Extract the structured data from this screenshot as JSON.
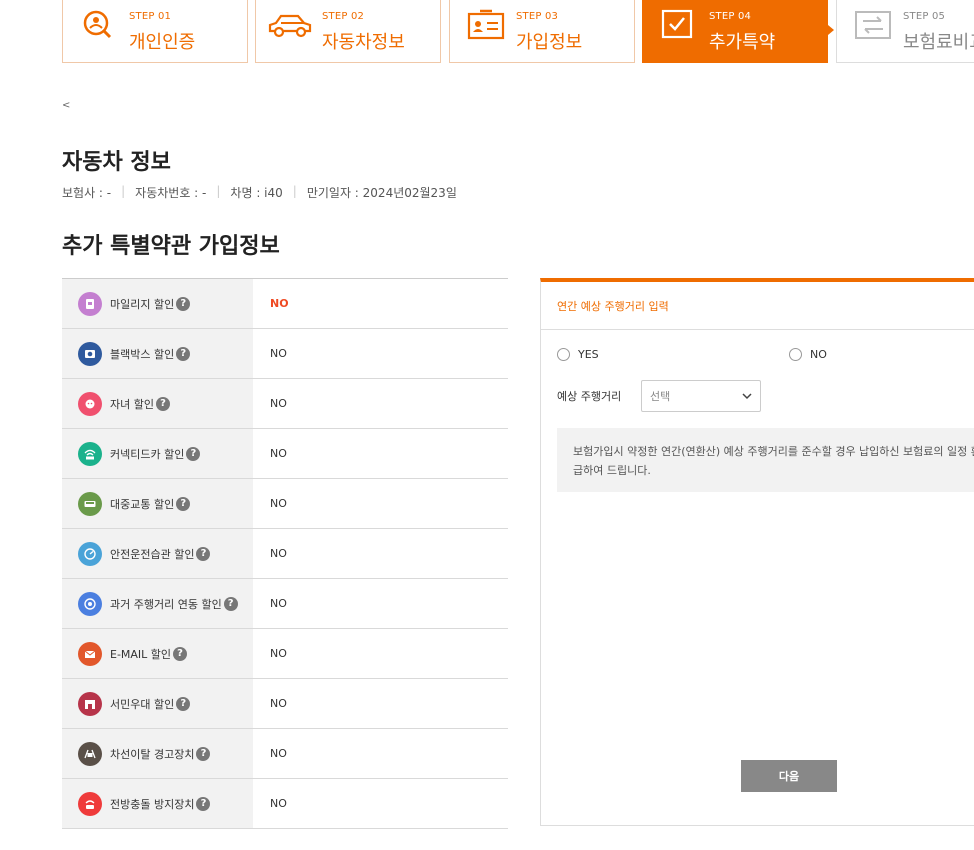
{
  "steps": [
    {
      "num": "STEP 01",
      "label": "개인인증",
      "icon": "search-person-icon",
      "state": "done"
    },
    {
      "num": "STEP 02",
      "label": "자동차정보",
      "icon": "car-icon",
      "state": "done"
    },
    {
      "num": "STEP 03",
      "label": "가입정보",
      "icon": "id-card-icon",
      "state": "done"
    },
    {
      "num": "STEP 04",
      "label": "추가특약",
      "icon": "check-box-icon",
      "state": "active"
    },
    {
      "num": "STEP 05",
      "label": "보험료비교",
      "icon": "compare-icon",
      "state": "disabled"
    }
  ],
  "back_label": "<",
  "car_info": {
    "title": "자동차 정보",
    "insurer": "보험사 : -",
    "car_number": "자동차번호 : -",
    "model": "차명 : i40",
    "expiry": "만기일자 : 2024년02월23일"
  },
  "special_terms": {
    "title": "추가 특별약관 가입정보",
    "rows": [
      {
        "label": "마일리지 할인",
        "value": "NO",
        "icon": "mileage-icon",
        "color": "#c47fd0",
        "highlight": true
      },
      {
        "label": "블랙박스 할인",
        "value": "NO",
        "icon": "blackbox-icon",
        "color": "#2f5a9e",
        "highlight": false
      },
      {
        "label": "자녀 할인",
        "value": "NO",
        "icon": "child-icon",
        "color": "#f0506e",
        "highlight": false
      },
      {
        "label": "커넥티드카 할인",
        "value": "NO",
        "icon": "connected-car-icon",
        "color": "#1bb28c",
        "highlight": false
      },
      {
        "label": "대중교통 할인",
        "value": "NO",
        "icon": "bus-icon",
        "color": "#6a9a4a",
        "highlight": false
      },
      {
        "label": "안전운전습관 할인",
        "value": "NO",
        "icon": "gauge-icon",
        "color": "#4aa3d8",
        "highlight": false
      },
      {
        "label": "과거 주행거리 연동 할인",
        "value": "NO",
        "icon": "odometer-icon",
        "color": "#4b7fe0",
        "highlight": false
      },
      {
        "label": "E-MAIL 할인",
        "value": "NO",
        "icon": "email-icon",
        "color": "#e2572b",
        "highlight": false
      },
      {
        "label": "서민우대 할인",
        "value": "NO",
        "icon": "store-icon",
        "color": "#b7344a",
        "highlight": false
      },
      {
        "label": "차선이탈 경고장치",
        "value": "NO",
        "icon": "lane-departure-icon",
        "color": "#5a5048",
        "highlight": false
      },
      {
        "label": "전방충돌 방지장치",
        "value": "NO",
        "icon": "collision-icon",
        "color": "#ef3b3b",
        "highlight": false
      }
    ]
  },
  "mileage_panel": {
    "title": "연간 예상 주행거리 입력",
    "yes_label": "YES",
    "no_label": "NO",
    "distance_label": "예상 주행거리",
    "select_value": "선택",
    "note": "보험가입시 약정한 연간(연환산) 예상 주행거리를 준수할 경우 납입하신 보험료의 일정 환급하여 드립니다.",
    "next_label": "다음"
  },
  "colors": {
    "accent": "#ef6c00",
    "highlight_text": "#ef4a23"
  }
}
